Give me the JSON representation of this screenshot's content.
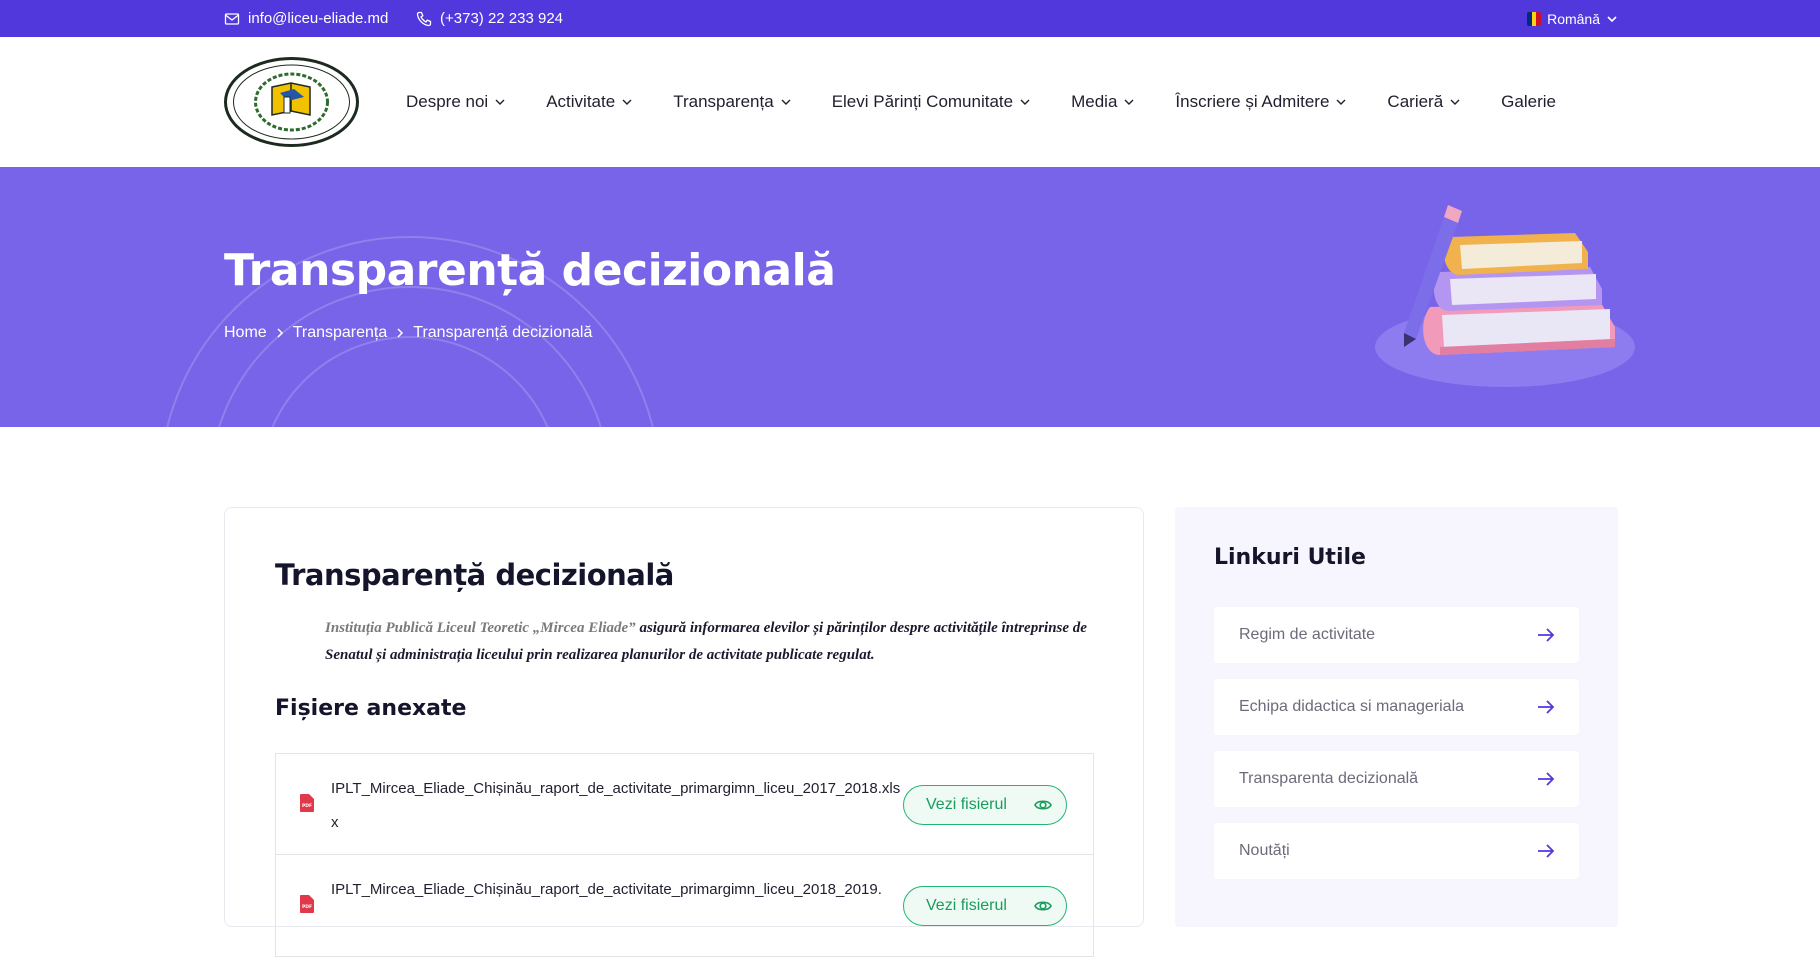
{
  "topbar": {
    "email": "info@liceu-eliade.md",
    "phone": "(+373) 22 233 924",
    "language": "Română",
    "flag_colors": [
      "#002b7f",
      "#fcd116",
      "#ce1126"
    ]
  },
  "header": {
    "logo_label": "INSTITUȚIA PUBLICĂ LICEUL TEORETIC „MIRCEA ELIADE”",
    "nav": [
      {
        "label": "Despre noi",
        "dropdown": true
      },
      {
        "label": "Activitate",
        "dropdown": true
      },
      {
        "label": "Transparența",
        "dropdown": true
      },
      {
        "label": "Elevi Părinți Comunitate",
        "dropdown": true
      },
      {
        "label": "Media",
        "dropdown": true
      },
      {
        "label": "Înscriere și Admitere",
        "dropdown": true
      },
      {
        "label": "Carieră",
        "dropdown": true
      },
      {
        "label": "Galerie",
        "dropdown": false
      }
    ]
  },
  "hero": {
    "title": "Transparență decizională",
    "breadcrumb": [
      "Home",
      "Transparența",
      "Transparență decizională"
    ]
  },
  "main": {
    "title": "Transparență decizională",
    "intro_lead": "Instituția Publică Liceul Teoretic „Mircea Eliade”",
    "intro_rest": " asigură informarea elevilor și părinților despre activitățile întreprinse de Senatul și administrația liceului prin realizarea planurilor de activitate publicate regulat.",
    "files_heading": "Fișiere anexate",
    "files": [
      {
        "name": "IPLT_Mircea_Eliade_Chișinău_raport_de_activitate_primargimn_liceu_2017_2018.xlsx",
        "button": "Vezi fisierul"
      },
      {
        "name": "IPLT_Mircea_Eliade_Chișinău_raport_de_activitate_primargimn_liceu_2018_2019.",
        "button": "Vezi fisierul"
      }
    ]
  },
  "sidebar": {
    "title": "Linkuri Utile",
    "links": [
      {
        "label": "Regim de activitate"
      },
      {
        "label": "Echipa didactica si manageriala"
      },
      {
        "label": "Transparenta decizională"
      },
      {
        "label": "Noutăți"
      }
    ]
  },
  "colors": {
    "topbar": "#5138dd",
    "hero": "#7864e8",
    "accent": "#5138dd",
    "success": "#22b573"
  }
}
